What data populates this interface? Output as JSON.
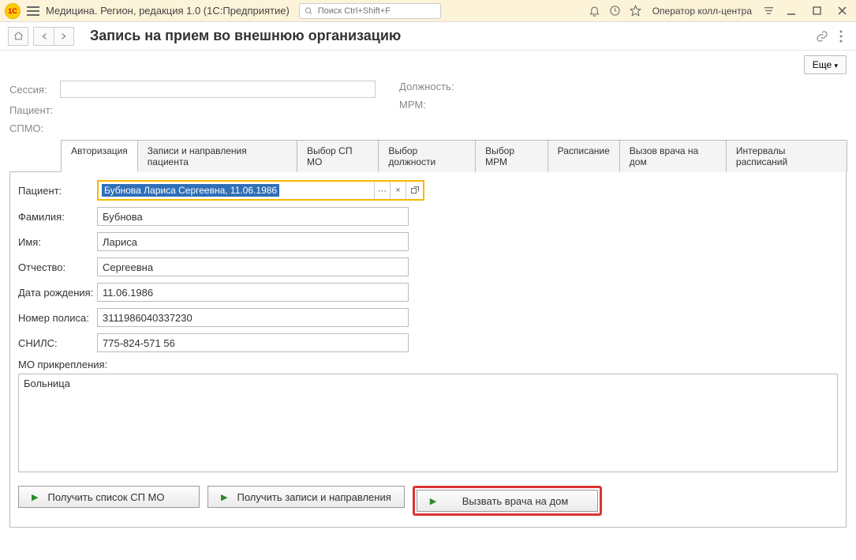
{
  "titlebar": {
    "app_title": "Медицина. Регион, редакция 1.0  (1С:Предприятие)",
    "search_placeholder": "Поиск Ctrl+Shift+F",
    "role": "Оператор колл-центра"
  },
  "page": {
    "title": "Запись на прием во внешнюю организацию",
    "more_label": "Еще"
  },
  "header": {
    "session_label": "Сессия:",
    "patient_label": "Пациент:",
    "spmo_label": "СПМО:",
    "position_label": "Должность:",
    "mrm_label": "МРМ:"
  },
  "tabs": [
    "Авторизация",
    "Записи и направления пациента",
    "Выбор СП МО",
    "Выбор должности",
    "Выбор МРМ",
    "Расписание",
    "Вызов врача на дом",
    "Интервалы расписаний"
  ],
  "form": {
    "patient_label": "Пациент:",
    "patient_value": "Бубнова Лариса Сергеевна, 11.06.1986",
    "lastname_label": "Фамилия:",
    "lastname_value": "Бубнова",
    "firstname_label": "Имя:",
    "firstname_value": "Лариса",
    "middlename_label": "Отчество:",
    "middlename_value": "Сергеевна",
    "birthdate_label": "Дата рождения:",
    "birthdate_value": "11.06.1986",
    "policy_label": "Номер полиса:",
    "policy_value": "3111986040337230",
    "snils_label": "СНИЛС:",
    "snils_value": "775-824-571 56",
    "mo_label": "МО прикрепления:",
    "mo_value": "Больница"
  },
  "actions": {
    "get_sp_mo": "Получить список СП МО",
    "get_records": "Получить записи и направления",
    "call_doctor": "Вызвать врача на дом"
  }
}
